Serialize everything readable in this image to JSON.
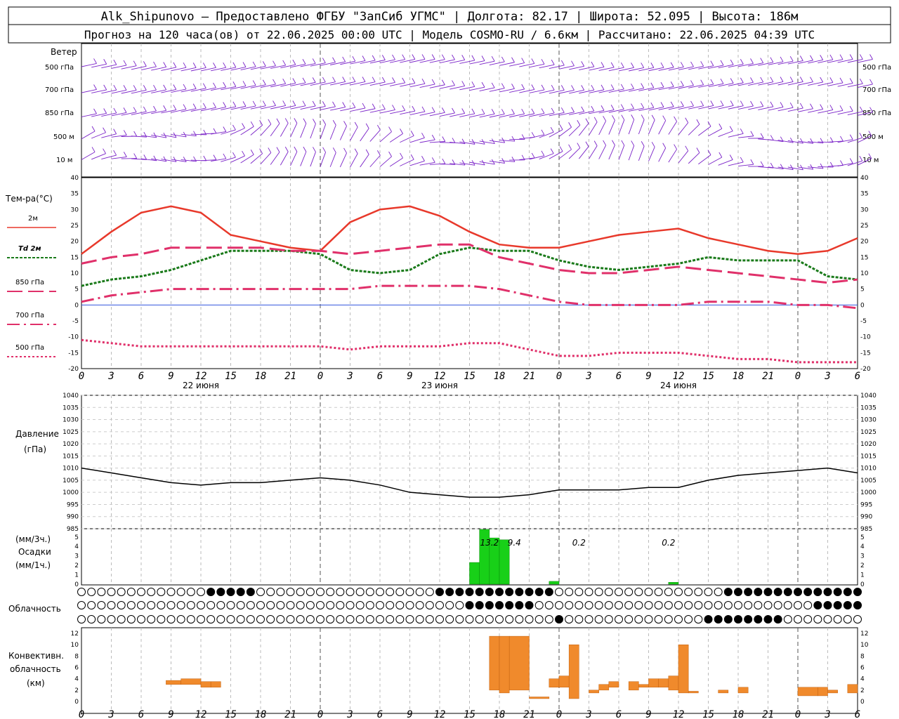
{
  "header": {
    "line1": "Alk_Shipunovo – Предоставлено ФГБУ \"ЗапСиб УГМС\" | Долгота: 82.17 | Широта: 52.095 | Высота: 186м",
    "line2": "Прогноз на 120 часа(ов) от 22.06.2025 00:00 UTC  | Модель COSMO-RU / 6.6км | Рассчитано: 22.06.2025 04:39 UTC"
  },
  "panels": {
    "wind": {
      "title": "Ветер",
      "levels": [
        "500 гПа",
        "700 гПа",
        "850 гПа",
        "500 м",
        "10 м"
      ]
    },
    "temp": {
      "title": "Тем-ра(°С)",
      "legend": [
        "2м",
        "Td 2м",
        "850 гПа",
        "700 гПа",
        "500 гПа"
      ],
      "yticks": [
        "40",
        "35",
        "30",
        "25",
        "20",
        "15",
        "10",
        "5",
        "0",
        "-5",
        "-10",
        "-15",
        "-20"
      ]
    },
    "pressure": {
      "title": "Давление",
      "unit": "(гПа)",
      "yticks": [
        "1040",
        "1035",
        "1030",
        "1025",
        "1020",
        "1015",
        "1010",
        "1005",
        "1000",
        "995",
        "990",
        "985"
      ]
    },
    "precip": {
      "title1": "(мм/3ч.)",
      "title2": "Осадки",
      "title3": "(мм/1ч.)",
      "yticks": [
        "5",
        "4",
        "3",
        "2",
        "1",
        "0"
      ],
      "labels": [
        "13.2",
        "9.4",
        "0.2",
        "0.2"
      ]
    },
    "clouds": {
      "title": "Облачность"
    },
    "convective": {
      "title1": "Конвективн.",
      "title2": "облачность",
      "title3": "(км)",
      "yticks": [
        "12",
        "10",
        "8",
        "6",
        "4",
        "2",
        "0"
      ]
    }
  },
  "x_axis": {
    "hour_labels": [
      "0",
      "3",
      "6",
      "9",
      "12",
      "15",
      "18",
      "21",
      "0",
      "3",
      "6",
      "9",
      "12",
      "15",
      "18",
      "21",
      "0",
      "3",
      "6",
      "9",
      "12",
      "15",
      "18",
      "21",
      "0",
      "3",
      "6"
    ],
    "day_labels": [
      "22 июня",
      "23 июня",
      "24 июня"
    ]
  },
  "chart_data": [
    {
      "type": "line",
      "title": "Тем-ра(°С)",
      "x_hours": [
        0,
        3,
        6,
        9,
        12,
        15,
        18,
        21,
        24,
        27,
        30,
        33,
        36,
        39,
        42,
        45,
        48,
        51,
        54,
        57,
        60,
        63,
        66,
        69,
        72,
        75,
        78
      ],
      "ylim": [
        -20,
        40
      ],
      "series": [
        {
          "name": "2м",
          "color": "#e8392b",
          "values": [
            16,
            23,
            29,
            31,
            29,
            22,
            20,
            18,
            17,
            26,
            30,
            31,
            28,
            23,
            19,
            18,
            18,
            20,
            22,
            23,
            24,
            21,
            19,
            17,
            16,
            17,
            21
          ]
        },
        {
          "name": "Td 2м",
          "color": "#1a7a1a",
          "values": [
            6,
            8,
            9,
            11,
            14,
            17,
            17,
            17,
            16,
            11,
            10,
            11,
            16,
            18,
            17,
            17,
            14,
            12,
            11,
            12,
            13,
            15,
            14,
            14,
            14,
            9,
            8
          ]
        },
        {
          "name": "850 гПа",
          "color": "#e0306a",
          "values": [
            13,
            15,
            16,
            18,
            18,
            18,
            18,
            17,
            17,
            16,
            17,
            18,
            19,
            19,
            15,
            13,
            11,
            10,
            10,
            11,
            12,
            11,
            10,
            9,
            8,
            7,
            8
          ]
        },
        {
          "name": "700 гПа",
          "color": "#e0306a",
          "values": [
            1,
            3,
            4,
            5,
            5,
            5,
            5,
            5,
            5,
            5,
            6,
            6,
            6,
            6,
            5,
            3,
            1,
            0,
            0,
            0,
            0,
            1,
            1,
            1,
            0,
            0,
            -1
          ]
        },
        {
          "name": "500 гПа",
          "color": "#e0306a",
          "values": [
            -11,
            -12,
            -13,
            -13,
            -13,
            -13,
            -13,
            -13,
            -13,
            -14,
            -13,
            -13,
            -13,
            -12,
            -12,
            -14,
            -16,
            -16,
            -15,
            -15,
            -15,
            -16,
            -17,
            -17,
            -18,
            -18,
            -18
          ]
        }
      ]
    },
    {
      "type": "line",
      "title": "Давление",
      "x_hours": [
        0,
        3,
        6,
        9,
        12,
        15,
        18,
        21,
        24,
        27,
        30,
        33,
        36,
        39,
        42,
        45,
        48,
        51,
        54,
        57,
        60,
        63,
        66,
        69,
        72,
        75,
        78
      ],
      "ylim": [
        985,
        1040
      ],
      "series": [
        {
          "values": [
            1010,
            1008,
            1006,
            1004,
            1003,
            1004,
            1004,
            1005,
            1006,
            1005,
            1003,
            1000,
            999,
            998,
            998,
            999,
            1001,
            1001,
            1001,
            1002,
            1002,
            1005,
            1007,
            1008,
            1009,
            1010,
            1008
          ]
        }
      ]
    },
    {
      "type": "bar",
      "title": "Осадки",
      "x_hours": [
        40,
        41,
        42,
        43,
        48,
        60
      ],
      "values": [
        2.3,
        5.8,
        4.9,
        4.7,
        0.3,
        0.2
      ],
      "ylim": [
        0,
        5.5
      ]
    },
    {
      "type": "bar",
      "title": "Конвективная облачность",
      "ylim": [
        0,
        13
      ],
      "bars": [
        {
          "x0": 8.5,
          "x1": 10,
          "bottom": 3.0,
          "top": 3.7
        },
        {
          "x0": 10,
          "x1": 12,
          "bottom": 3.0,
          "top": 4.0
        },
        {
          "x0": 12,
          "x1": 13,
          "bottom": 2.5,
          "top": 3.5
        },
        {
          "x0": 13,
          "x1": 14,
          "bottom": 2.5,
          "top": 3.5
        },
        {
          "x0": 41,
          "x1": 42,
          "bottom": 2.0,
          "top": 11.5
        },
        {
          "x0": 42,
          "x1": 43,
          "bottom": 1.5,
          "top": 11.5
        },
        {
          "x0": 43,
          "x1": 45,
          "bottom": 2.0,
          "top": 11.5
        },
        {
          "x0": 45,
          "x1": 47,
          "bottom": 0.5,
          "top": 0.8
        },
        {
          "x0": 47,
          "x1": 48,
          "bottom": 2.5,
          "top": 4.0
        },
        {
          "x0": 48,
          "x1": 49,
          "bottom": 2.5,
          "top": 4.5
        },
        {
          "x0": 49,
          "x1": 50,
          "bottom": 0.5,
          "top": 10.0
        },
        {
          "x0": 51,
          "x1": 52,
          "bottom": 1.5,
          "top": 2.0
        },
        {
          "x0": 52,
          "x1": 53,
          "bottom": 2.0,
          "top": 3.0
        },
        {
          "x0": 53,
          "x1": 54,
          "bottom": 2.5,
          "top": 3.5
        },
        {
          "x0": 55,
          "x1": 56,
          "bottom": 2.0,
          "top": 3.5
        },
        {
          "x0": 56,
          "x1": 57,
          "bottom": 2.5,
          "top": 3.0
        },
        {
          "x0": 57,
          "x1": 58,
          "bottom": 2.5,
          "top": 4.0
        },
        {
          "x0": 58,
          "x1": 59,
          "bottom": 2.5,
          "top": 4.0
        },
        {
          "x0": 59,
          "x1": 60,
          "bottom": 2.0,
          "top": 4.5
        },
        {
          "x0": 60,
          "x1": 61,
          "bottom": 1.5,
          "top": 10.0
        },
        {
          "x0": 61,
          "x1": 62,
          "bottom": 1.5,
          "top": 1.8
        },
        {
          "x0": 64,
          "x1": 65,
          "bottom": 1.5,
          "top": 2.0
        },
        {
          "x0": 66,
          "x1": 67,
          "bottom": 1.5,
          "top": 2.5
        },
        {
          "x0": 72,
          "x1": 74,
          "bottom": 1.0,
          "top": 2.5
        },
        {
          "x0": 74,
          "x1": 75,
          "bottom": 1.0,
          "top": 2.5
        },
        {
          "x0": 75,
          "x1": 76,
          "bottom": 1.5,
          "top": 2.0
        },
        {
          "x0": 77,
          "x1": 78,
          "bottom": 1.5,
          "top": 3.0
        }
      ]
    }
  ]
}
